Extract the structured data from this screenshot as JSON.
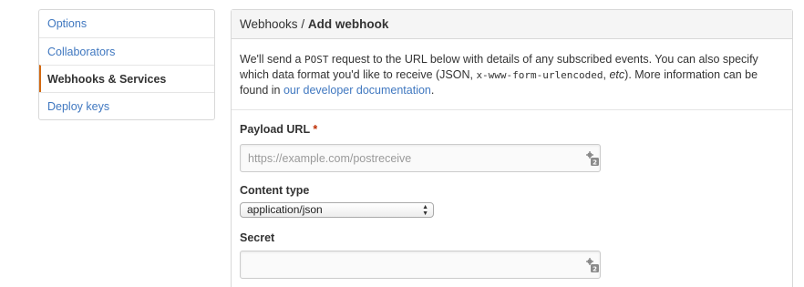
{
  "sidebar": {
    "items": [
      {
        "label": "Options"
      },
      {
        "label": "Collaborators"
      },
      {
        "label": "Webhooks & Services"
      },
      {
        "label": "Deploy keys"
      }
    ]
  },
  "header": {
    "breadcrumb_parent": "Webhooks",
    "separator": "/",
    "title": "Add webhook"
  },
  "intro": {
    "text_1": "We'll send a ",
    "code_1": "POST",
    "text_2": " request to the URL below with details of any subscribed events. You can also specify which data format you'd like to receive (JSON, ",
    "code_2": "x-www-form-urlencoded",
    "text_3": ", ",
    "em_1": "etc",
    "text_4": "). More information can be found in ",
    "link": "our developer documentation",
    "text_5": "."
  },
  "form": {
    "payload_url": {
      "label": "Payload URL",
      "required_mark": "*",
      "value": "",
      "placeholder": "https://example.com/postreceive"
    },
    "content_type": {
      "label": "Content type",
      "selected": "application/json"
    },
    "secret": {
      "label": "Secret",
      "value": "",
      "placeholder": ""
    }
  },
  "colors": {
    "link": "#4078c0",
    "selected_accent": "#d26911",
    "required": "#bd2c00"
  },
  "icons": {
    "field_icon": "password-manager-key-icon"
  }
}
